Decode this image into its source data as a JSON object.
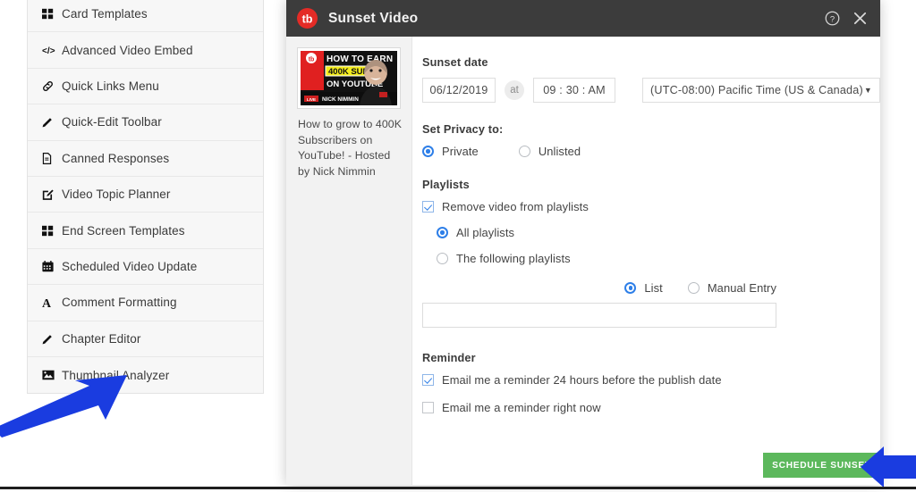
{
  "sidebar": {
    "items": [
      {
        "label": "Card Templates",
        "icon": "grid-icon"
      },
      {
        "label": "Advanced Video Embed",
        "icon": "code-icon"
      },
      {
        "label": "Quick Links Menu",
        "icon": "link-icon"
      },
      {
        "label": "Quick-Edit Toolbar",
        "icon": "pencil-icon"
      },
      {
        "label": "Canned Responses",
        "icon": "document-icon"
      },
      {
        "label": "Video Topic Planner",
        "icon": "edit-square-icon"
      },
      {
        "label": "End Screen Templates",
        "icon": "grid-icon"
      },
      {
        "label": "Scheduled Video Update",
        "icon": "calendar-icon"
      },
      {
        "label": "Comment Formatting",
        "icon": "letter-a-icon"
      },
      {
        "label": "Chapter Editor",
        "icon": "pencil-icon"
      },
      {
        "label": "Thumbnail Analyzer",
        "icon": "image-icon"
      }
    ]
  },
  "modal": {
    "title": "Sunset Video",
    "logo_text": "tb",
    "help_icon": "question-circle-icon",
    "close_icon": "close-icon",
    "video": {
      "thumbnail_lines": [
        "HOW TO EARN",
        "400K SUBS",
        "ON YOUTUBE"
      ],
      "thumbnail_footer_live": "LIVE",
      "thumbnail_footer_name": "NICK NIMMIN",
      "title": "How to grow to 400K Subscribers on YouTube! - Hosted by Nick Nimmin"
    },
    "sunset_date": {
      "label": "Sunset date",
      "date_value": "06/12/2019",
      "at_label": "at",
      "time_value": "09 : 30 : AM",
      "timezone_value": "(UTC-08:00) Pacific Time (US & Canada)",
      "timezone_caret": "▼"
    },
    "privacy": {
      "label": "Set Privacy to:",
      "options": [
        {
          "label": "Private",
          "selected": true
        },
        {
          "label": "Unlisted",
          "selected": false
        }
      ]
    },
    "playlists": {
      "label": "Playlists",
      "remove_checkbox": {
        "label": "Remove video from playlists",
        "checked": true
      },
      "options": [
        {
          "label": "All playlists",
          "selected": true
        },
        {
          "label": "The following playlists",
          "selected": false
        }
      ],
      "mode_options": [
        {
          "label": "List",
          "selected": true
        },
        {
          "label": "Manual Entry",
          "selected": false
        }
      ],
      "input_value": "",
      "input_placeholder": ""
    },
    "reminder": {
      "label": "Reminder",
      "options": [
        {
          "label": "Email me a reminder 24 hours before the publish date",
          "checked": true
        },
        {
          "label": "Email me a reminder right now",
          "checked": false
        }
      ]
    },
    "submit_label": "SCHEDULE SUNSET"
  },
  "annotations": {
    "arrow_color": "#1a3ce0",
    "arrow_left_target": "Thumbnail Analyzer",
    "arrow_right_target": "SCHEDULE SUNSET"
  },
  "colors": {
    "header_bg": "#3c3c3c",
    "brand_red": "#e42b26",
    "accent_blue": "#2e7fe8",
    "submit_green": "#5cb85c"
  }
}
